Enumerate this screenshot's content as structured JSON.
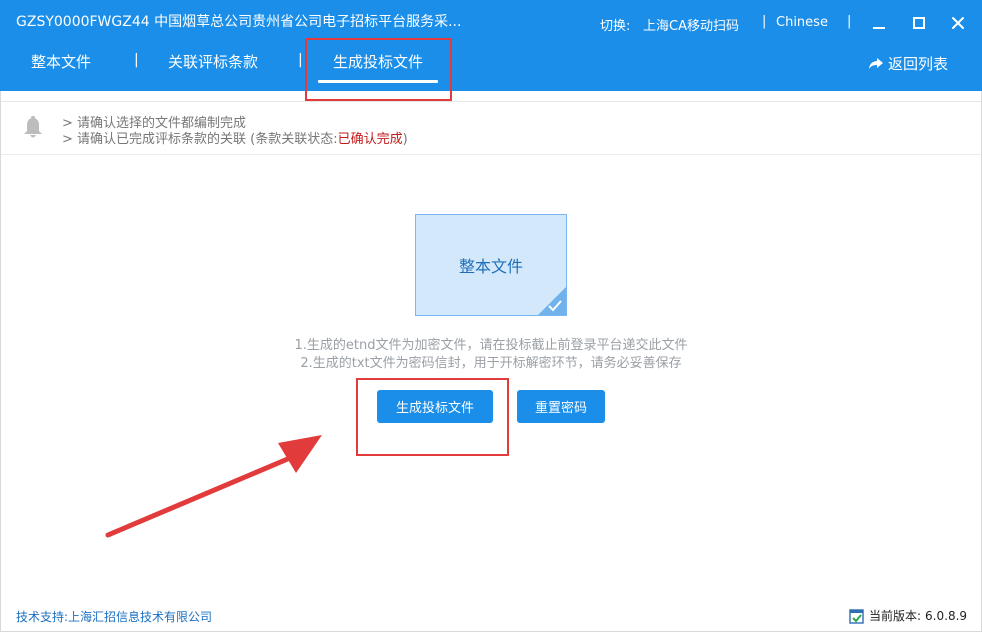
{
  "window": {
    "title": "GZSY0000FWGZ44 中国烟草总公司贵州省公司电子招标平台服务采...",
    "switch_label": "切换:",
    "ca_link": "上海CA移动扫码",
    "separator": "|",
    "language": "Chinese"
  },
  "nav": {
    "tabs": [
      {
        "label": "整本文件"
      },
      {
        "label": "关联评标条款"
      },
      {
        "label": "生成投标文件"
      }
    ],
    "separator": "|",
    "back_label": "返回列表"
  },
  "notice": {
    "line1": "> 请确认选择的文件都编制完成",
    "line2_prefix": "> 请确认已完成评标条款的关联  (条款关联状态:",
    "line2_status": "已确认完成",
    "line2_suffix": ")"
  },
  "main": {
    "file_card_label": "整本文件",
    "hint1": "1.生成的etnd文件为加密文件，请在投标截止前登录平台递交此文件",
    "hint2": "2.生成的txt文件为密码信封，用于开标解密环节，请务必妥善保存",
    "generate_button": "生成投标文件",
    "reset_button": "重置密码"
  },
  "footer": {
    "support": "技术支持:上海汇招信息技术有限公司",
    "version_label": "当前版本:",
    "version": "6.0.8.9"
  },
  "colors": {
    "brand": "#1a8ee8",
    "highlight_box": "#e23b3b",
    "status_red": "#c21b1b",
    "arrow": "#e23b3b"
  }
}
